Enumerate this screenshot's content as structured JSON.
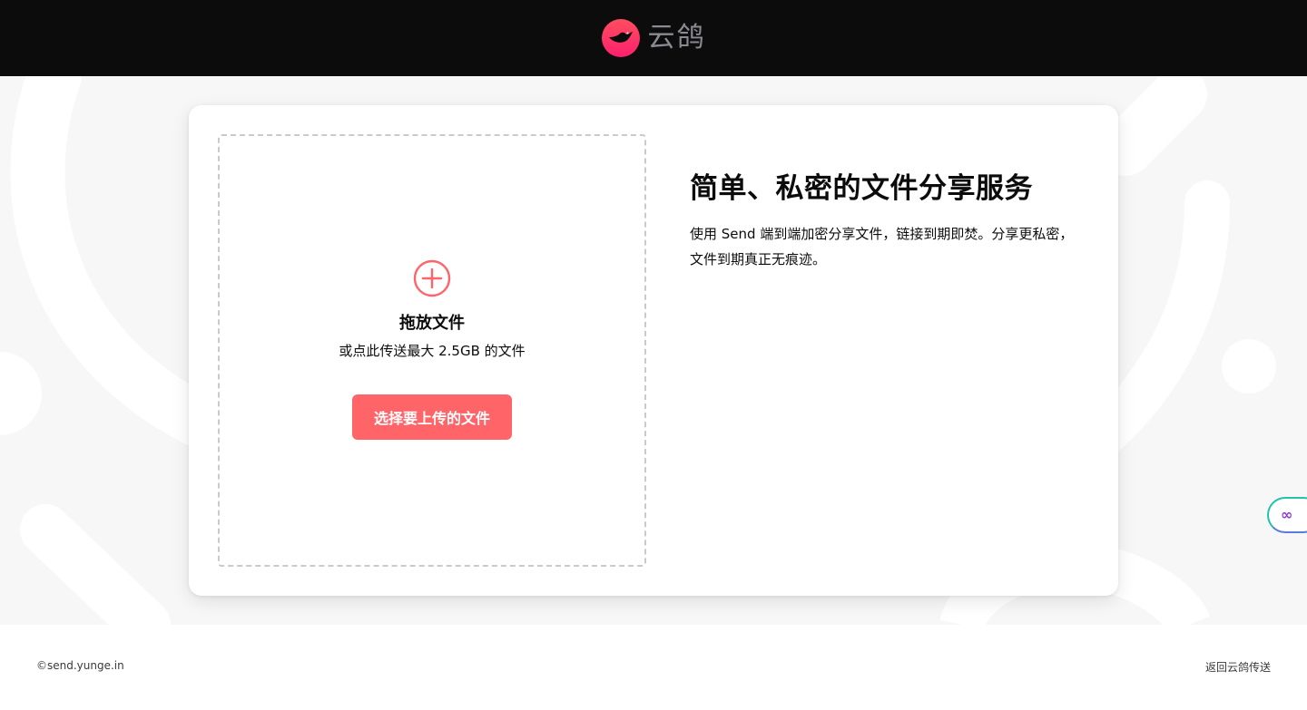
{
  "header": {
    "brand_name": "云鸽",
    "colors": {
      "background": "#0c0c0d",
      "brand_text": "#8a8a91",
      "logo": "#ff3d55"
    },
    "logo_icon": "pigeon-logo-icon"
  },
  "upload": {
    "icon": "plus-circle-icon",
    "title": "拖放文件",
    "subtitle": "或点此传送最大 2.5GB 的文件",
    "button_label": "选择要上传的文件",
    "accent_color": "#fe6468"
  },
  "intro": {
    "title": "简单、私密的文件分享服务",
    "description": "使用 Send 端到端加密分享文件，链接到期即焚。分享更私密，文件到期真正无痕迹。"
  },
  "footer": {
    "copyright": "©send.yunge.in",
    "back_link": "返回云鸽传送"
  },
  "side_widget": {
    "icon": "infinity-icon",
    "glyph": "∞"
  }
}
